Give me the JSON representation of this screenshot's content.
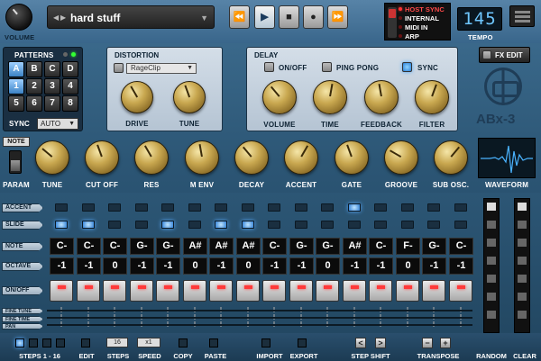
{
  "header": {
    "volume_label": "VOLUME",
    "preset_name": "hard stuff",
    "transport": [
      "⏪",
      "▶",
      "■",
      "●",
      "⏩"
    ],
    "sync_options": [
      {
        "label": "HOST SYNC",
        "active": true
      },
      {
        "label": "INTERNAL",
        "active": false
      },
      {
        "label": "MIDI IN",
        "active": false
      },
      {
        "label": "ARP",
        "active": false
      }
    ],
    "tempo_value": "145",
    "tempo_label": "TEMPO"
  },
  "patterns": {
    "title": "PATTERNS",
    "banks": [
      "A",
      "B",
      "C",
      "D"
    ],
    "numbers": [
      "1",
      "2",
      "3",
      "4",
      "5",
      "6",
      "7",
      "8"
    ],
    "selected_bank": "A",
    "selected_number": "1",
    "sync_label": "SYNC",
    "sync_value": "AUTO"
  },
  "distortion": {
    "title": "DISTORTION",
    "type_value": "RageClip",
    "knobs": [
      "DRIVE",
      "TUNE"
    ]
  },
  "delay": {
    "title": "DELAY",
    "toggles": [
      {
        "label": "ON/OFF",
        "active": false
      },
      {
        "label": "PING PONG",
        "active": false
      },
      {
        "label": "SYNC",
        "active": true
      }
    ],
    "knobs": [
      "VOLUME",
      "TIME",
      "FEEDBACK",
      "FILTER"
    ]
  },
  "fx_edit_label": "FX EDIT",
  "logo_text": "ABx-3",
  "controls": {
    "note_label": "NOTE",
    "param_label": "PARAM",
    "knobs": [
      "TUNE",
      "CUT OFF",
      "RES",
      "M ENV",
      "DECAY",
      "ACCENT",
      "GATE",
      "GROOVE",
      "SUB OSC."
    ],
    "waveform_label": "WAVEFORM"
  },
  "sequencer": {
    "row_labels": {
      "accent": "ACCENT",
      "slide": "SLIDE",
      "note": "NOTE",
      "octave": "OCTAVE",
      "onoff": "ON/OFF",
      "fine_tune": "FINE TUNE",
      "fine_time": "FINE TIME",
      "pan": "PAN"
    },
    "accent": [
      false,
      false,
      false,
      false,
      false,
      false,
      false,
      false,
      false,
      false,
      false,
      true,
      false,
      false,
      false,
      false
    ],
    "slide": [
      true,
      true,
      false,
      false,
      true,
      false,
      true,
      true,
      false,
      false,
      false,
      false,
      false,
      false,
      false,
      false
    ],
    "notes": [
      "C-",
      "C-",
      "C-",
      "G-",
      "G-",
      "A#",
      "A#",
      "A#",
      "C-",
      "G-",
      "G-",
      "A#",
      "C-",
      "F-",
      "G-",
      "C-"
    ],
    "octaves": [
      "-1",
      "-1",
      "0",
      "-1",
      "-1",
      "0",
      "-1",
      "0",
      "-1",
      "-1",
      "0",
      "-1",
      "-1",
      "0",
      "-1",
      "-1"
    ]
  },
  "bottom": {
    "step_indicators": [
      true,
      false,
      false,
      false
    ],
    "steps_range": "STEPS 1 - 16",
    "steps_value": "16",
    "speed_value": "x1",
    "labels": [
      "EDIT",
      "STEPS",
      "SPEED",
      "COPY",
      "PASTE",
      "IMPORT",
      "EXPORT",
      "STEP SHIFT",
      "TRANSPOSE",
      "RANDOM",
      "CLEAR"
    ],
    "shift_left": "<",
    "shift_right": ">",
    "transpose_down": "−",
    "transpose_up": "+"
  },
  "colors": {
    "accent_led": "#2f7fd6",
    "on_led": "#ff3a3a",
    "tempo_digits": "#6ec6ff",
    "host_sync": "#ff4a4a"
  }
}
